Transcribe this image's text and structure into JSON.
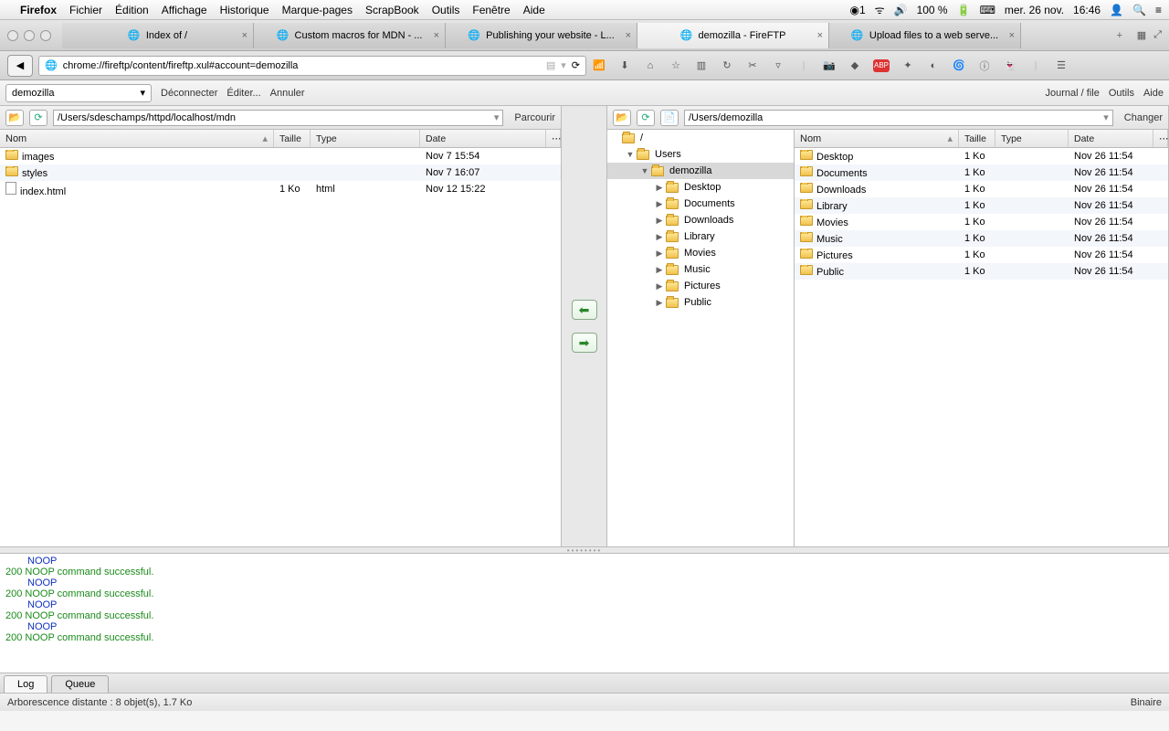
{
  "menubar": {
    "app": "Firefox",
    "items": [
      "Fichier",
      "Édition",
      "Affichage",
      "Historique",
      "Marque-pages",
      "ScrapBook",
      "Outils",
      "Fenêtre",
      "Aide"
    ],
    "cc_badge": "1",
    "battery": "100 %",
    "date": "mer. 26 nov.",
    "time": "16:46"
  },
  "tabs": [
    {
      "label": "Index of /",
      "active": false
    },
    {
      "label": "Custom macros for MDN - ...",
      "active": false
    },
    {
      "label": "Publishing your website - L...",
      "active": false
    },
    {
      "label": "demozilla - FireFTP",
      "active": true
    },
    {
      "label": "Upload files to a web serve...",
      "active": false
    }
  ],
  "url": "chrome://fireftp/content/fireftp.xul#account=demozilla",
  "ftpbar": {
    "account": "demozilla",
    "disconnect": "Déconnecter",
    "edit": "Éditer...",
    "abort": "Annuler",
    "journal": "Journal / file",
    "tools": "Outils",
    "help": "Aide"
  },
  "local": {
    "path": "/Users/sdeschamps/httpd/localhost/mdn",
    "browse": "Parcourir",
    "cols": {
      "name": "Nom",
      "size": "Taille",
      "type": "Type",
      "date": "Date"
    },
    "rows": [
      {
        "icon": "folder",
        "name": "images",
        "size": "",
        "type": "",
        "date": "Nov 7 15:54"
      },
      {
        "icon": "folder",
        "name": "styles",
        "size": "",
        "type": "",
        "date": "Nov 7 16:07"
      },
      {
        "icon": "file",
        "name": "index.html",
        "size": "1 Ko",
        "type": "html",
        "date": "Nov 12 15:22"
      }
    ]
  },
  "remote": {
    "path": "/Users/demozilla",
    "change": "Changer",
    "cols": {
      "name": "Nom",
      "size": "Taille",
      "type": "Type",
      "date": "Date"
    },
    "tree": [
      {
        "depth": 0,
        "expand": "",
        "name": "/"
      },
      {
        "depth": 1,
        "expand": "▼",
        "name": "Users"
      },
      {
        "depth": 2,
        "expand": "▼",
        "name": "demozilla",
        "sel": true
      },
      {
        "depth": 3,
        "expand": "▶",
        "name": "Desktop"
      },
      {
        "depth": 3,
        "expand": "▶",
        "name": "Documents"
      },
      {
        "depth": 3,
        "expand": "▶",
        "name": "Downloads"
      },
      {
        "depth": 3,
        "expand": "▶",
        "name": "Library"
      },
      {
        "depth": 3,
        "expand": "▶",
        "name": "Movies"
      },
      {
        "depth": 3,
        "expand": "▶",
        "name": "Music"
      },
      {
        "depth": 3,
        "expand": "▶",
        "name": "Pictures"
      },
      {
        "depth": 3,
        "expand": "▶",
        "name": "Public"
      }
    ],
    "rows": [
      {
        "name": "Desktop",
        "size": "1 Ko",
        "type": "",
        "date": "Nov 26 11:54"
      },
      {
        "name": "Documents",
        "size": "1 Ko",
        "type": "",
        "date": "Nov 26 11:54"
      },
      {
        "name": "Downloads",
        "size": "1 Ko",
        "type": "",
        "date": "Nov 26 11:54"
      },
      {
        "name": "Library",
        "size": "1 Ko",
        "type": "",
        "date": "Nov 26 11:54"
      },
      {
        "name": "Movies",
        "size": "1 Ko",
        "type": "",
        "date": "Nov 26 11:54"
      },
      {
        "name": "Music",
        "size": "1 Ko",
        "type": "",
        "date": "Nov 26 11:54"
      },
      {
        "name": "Pictures",
        "size": "1 Ko",
        "type": "",
        "date": "Nov 26 11:54"
      },
      {
        "name": "Public",
        "size": "1 Ko",
        "type": "",
        "date": "Nov 26 11:54"
      }
    ]
  },
  "log_lines": [
    {
      "cls": "b",
      "text": "NOOP"
    },
    {
      "cls": "g",
      "text": "200 NOOP command successful."
    },
    {
      "cls": "b",
      "text": "NOOP"
    },
    {
      "cls": "g",
      "text": "200 NOOP command successful."
    },
    {
      "cls": "b",
      "text": "NOOP"
    },
    {
      "cls": "g",
      "text": "200 NOOP command successful."
    },
    {
      "cls": "b",
      "text": "NOOP"
    },
    {
      "cls": "g",
      "text": "200 NOOP command successful."
    }
  ],
  "bottom_tabs": {
    "log": "Log",
    "queue": "Queue"
  },
  "status": {
    "left": "Arborescence distante : 8 objet(s), 1.7 Ko",
    "right": "Binaire"
  }
}
